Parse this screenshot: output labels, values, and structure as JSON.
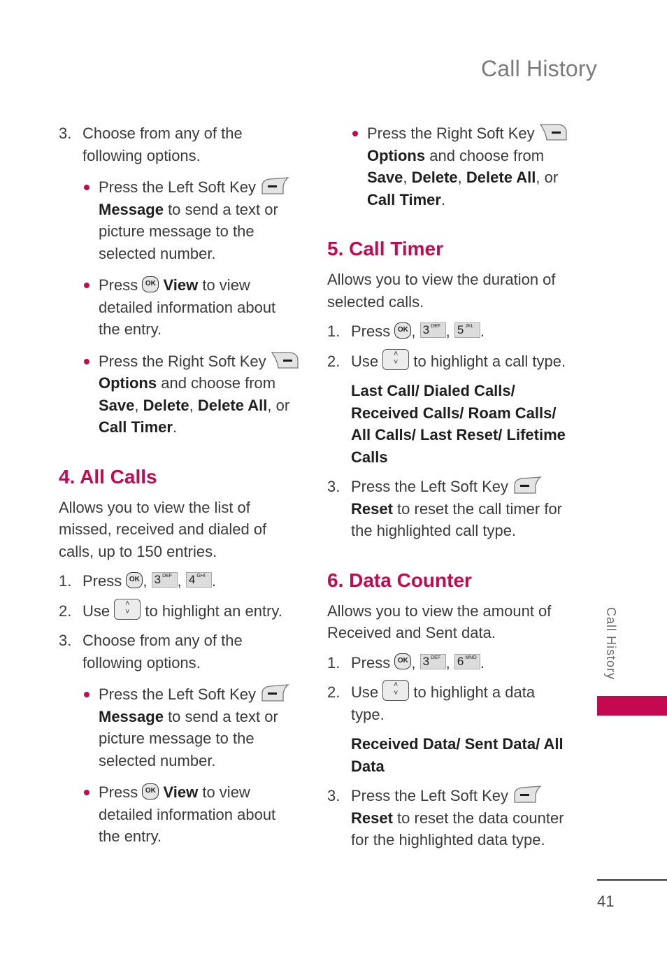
{
  "header": {
    "title": "Call History"
  },
  "side_tab": {
    "label": "Call History",
    "accent_color": "#c40a4e"
  },
  "footer": {
    "page_number": "41"
  },
  "colors": {
    "accent": "#c40a4e",
    "body_text": "#3a3a3a",
    "title_gray": "#7b7b7d"
  },
  "keys": {
    "ok": "OK",
    "three": {
      "digit": "3",
      "letters": "DEF"
    },
    "four": {
      "digit": "4",
      "letters": "GHI"
    },
    "five": {
      "digit": "5",
      "letters": "JKL"
    },
    "six": {
      "digit": "6",
      "letters": "MNO"
    },
    "nav_up": "˄",
    "nav_down": "˅"
  },
  "left": {
    "step3": {
      "num": "3.",
      "text": "Choose from any of the following options."
    },
    "bullets_a": [
      {
        "pre": "Press the Left Soft Key ",
        "icon": "left-soft-key-icon",
        "bold": "Message",
        "post": " to send a text or picture message to the selected number."
      },
      {
        "pre": "Press ",
        "icon": "ok-key-icon",
        "bold": "View",
        "post": " to view detailed information about the entry."
      },
      {
        "pre": "Press the Right Soft Key ",
        "icon": "right-soft-key-icon",
        "bold": "Options",
        "post": " and choose from ",
        "options": [
          "Save",
          "Delete",
          "Delete All",
          "Call Timer"
        ]
      }
    ],
    "section4": {
      "heading": "4. All Calls",
      "intro": "Allows you to view the list of missed, received and dialed of calls, up to 150 entries.",
      "step1": {
        "num": "1.",
        "text": "Press"
      },
      "step2": {
        "num": "2.",
        "pre": "Use",
        "post": "to highlight an entry."
      },
      "step3": {
        "num": "3.",
        "text": "Choose from any of the following options."
      },
      "bullets": [
        {
          "pre": "Press the Left Soft Key ",
          "bold": "Message",
          "post": " to send a text or picture message to the selected number."
        },
        {
          "pre": "Press ",
          "bold": "View",
          "post": " to view detailed information about the entry."
        }
      ]
    }
  },
  "right": {
    "bullet_top": {
      "pre": "Press the Right Soft Key ",
      "bold": "Options",
      "post": " and choose from ",
      "options": [
        "Save",
        "Delete",
        "Delete All",
        "Call Timer"
      ]
    },
    "section5": {
      "heading": "5. Call Timer",
      "intro": "Allows you to view the duration of selected calls.",
      "step1": {
        "num": "1.",
        "text": "Press"
      },
      "step2": {
        "num": "2.",
        "pre": "Use",
        "post": "to highlight a call type."
      },
      "types": "Last Call/ Dialed Calls/ Received Calls/ Roam Calls/ All Calls/ Last Reset/ Lifetime Calls",
      "step3": {
        "num": "3.",
        "pre": "Press the Left Soft Key",
        "bold": "Reset",
        "post": " to reset the call timer for the highlighted call type."
      }
    },
    "section6": {
      "heading": "6. Data Counter",
      "intro": "Allows you to view the amount of Received and Sent data.",
      "step1": {
        "num": "1.",
        "text": "Press"
      },
      "step2": {
        "num": "2.",
        "pre": "Use",
        "post": "to highlight a data type."
      },
      "types": "Received Data/ Sent Data/ All Data",
      "step3": {
        "num": "3.",
        "pre": "Press the Left Soft Key",
        "bold": "Reset",
        "post": " to reset the data counter for the highlighted data type."
      }
    }
  },
  "punct": {
    "comma": ", ",
    "period": ".",
    "or": ", or ",
    "sep": ", "
  }
}
